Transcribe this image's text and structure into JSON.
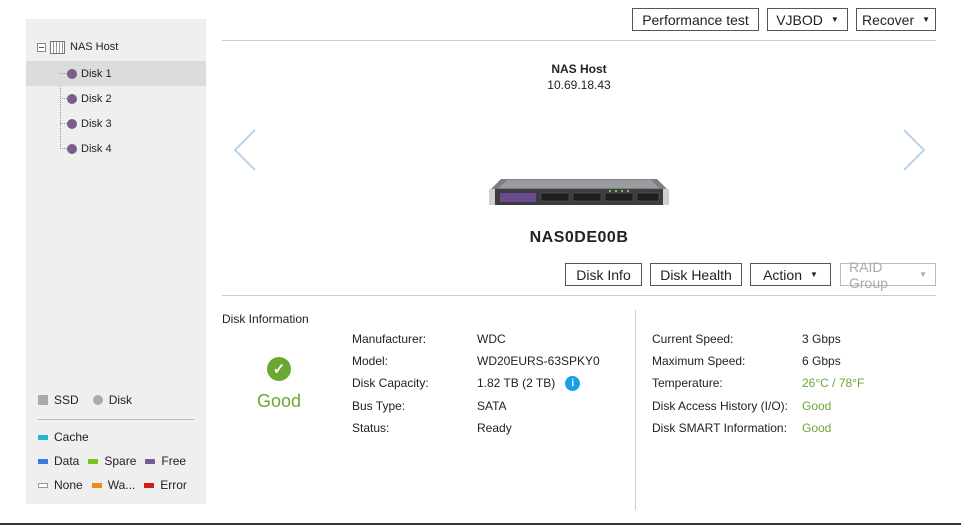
{
  "sidebar": {
    "root_label": "NAS Host",
    "items": [
      {
        "label": "Disk 1"
      },
      {
        "label": "Disk 2"
      },
      {
        "label": "Disk 3"
      },
      {
        "label": "Disk 4"
      }
    ],
    "legend": {
      "type": [
        {
          "label": "SSD"
        },
        {
          "label": "Disk"
        }
      ],
      "status": [
        {
          "label": "Cache",
          "color": "#1fb9c9"
        },
        {
          "label": "Data",
          "color": "#3b7be0"
        },
        {
          "label": "Spare",
          "color": "#7ac31e"
        },
        {
          "label": "Free",
          "color": "#7a5c8e"
        },
        {
          "label": "None",
          "color": "#ffffff"
        },
        {
          "label": "Wa...",
          "color": "#f08a1e"
        },
        {
          "label": "Error",
          "color": "#d11c1c"
        }
      ]
    }
  },
  "toolbar": {
    "performance_test": "Performance test",
    "vjbod": "VJBOD",
    "recover": "Recover"
  },
  "host": {
    "name": "NAS Host",
    "ip": "10.69.18.43",
    "device_name": "NAS0DE00B"
  },
  "actions": {
    "disk_info": "Disk Info",
    "disk_health": "Disk Health",
    "action": "Action",
    "raid_group": "RAID Group"
  },
  "disk_information": {
    "title": "Disk Information",
    "status": "Good",
    "left": [
      {
        "key": "Manufacturer:",
        "value": "WDC"
      },
      {
        "key": "Model:",
        "value": "WD20EURS-63SPKY0"
      },
      {
        "key": "Disk Capacity:",
        "value": "1.82 TB (2 TB)"
      },
      {
        "key": "Bus Type:",
        "value": "SATA"
      },
      {
        "key": "Status:",
        "value": "Ready"
      }
    ],
    "right": [
      {
        "key": "Current Speed:",
        "value": "3 Gbps"
      },
      {
        "key": "Maximum Speed:",
        "value": "6 Gbps"
      },
      {
        "key": "Temperature:",
        "value": "26°C / 78°F"
      },
      {
        "key": "Disk Access History (I/O):",
        "value": "Good"
      },
      {
        "key": "Disk SMART Information:",
        "value": "Good"
      }
    ]
  },
  "icons": {
    "status_check": "✓",
    "info": "i"
  },
  "colors": {
    "good": "#6aa832",
    "disk_dot": "#7a5c8e",
    "info": "#1aa0e6"
  }
}
